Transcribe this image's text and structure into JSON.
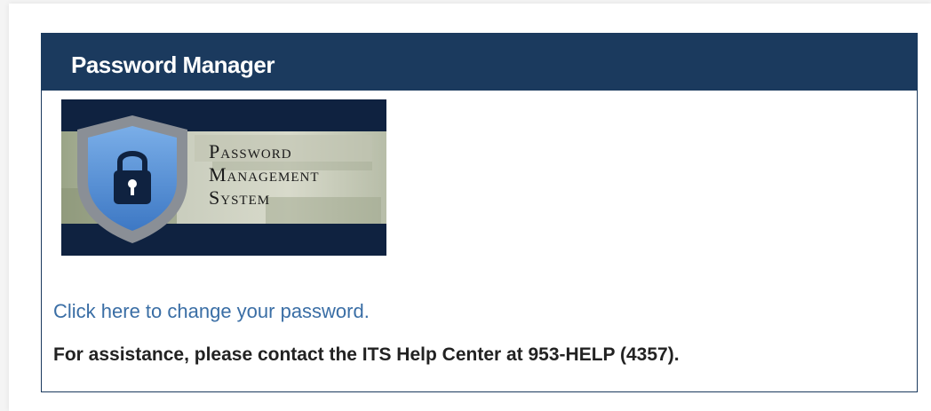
{
  "panel": {
    "title": "Password Manager",
    "banner": {
      "icon": "shield-lock-icon",
      "line1": "Password",
      "line2": "Management",
      "line3": "System"
    },
    "change_link": "Click here to change your password.",
    "assistance": "For assistance, please contact the ITS Help Center at 953-HELP (4357)."
  },
  "colors": {
    "header_bg": "#1b3a5e",
    "link": "#3a6ea5",
    "banner_dark": "#0f2240",
    "shield_outer": "#8a8f96",
    "shield_inner": "#5b93d6"
  }
}
